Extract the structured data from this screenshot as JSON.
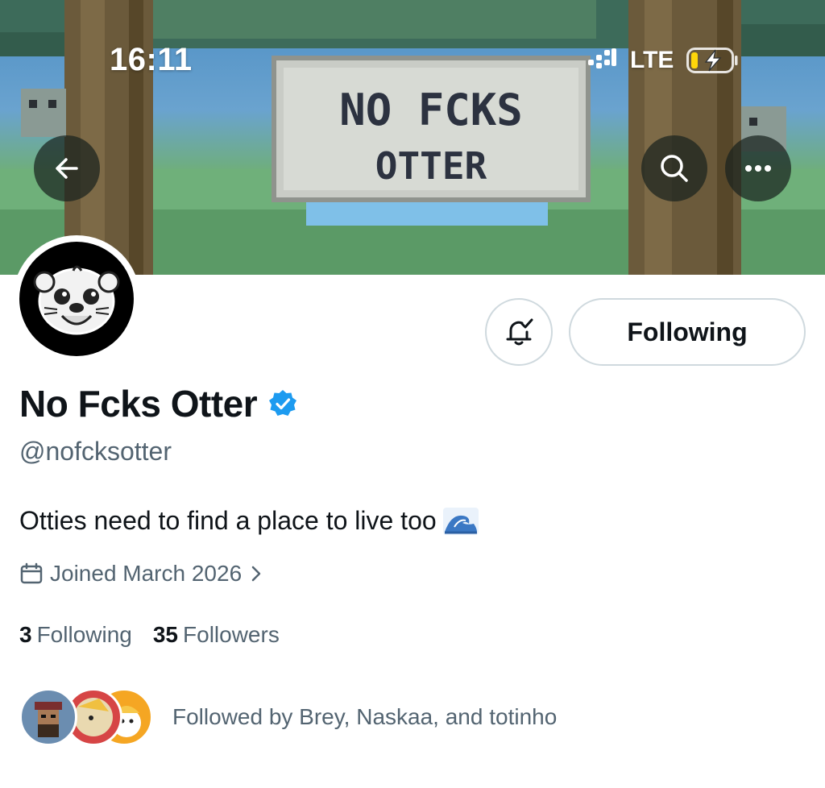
{
  "status_bar": {
    "time": "16:11",
    "network": "LTE",
    "icons": [
      "signal-icon",
      "battery-charging-icon"
    ]
  },
  "banner": {
    "sign_line1": "NO FCKS",
    "sign_line2": "OTTER",
    "buttons": [
      "back-arrow-icon",
      "search-icon",
      "more-icon"
    ]
  },
  "profile": {
    "display_name": "No Fcks Otter",
    "verified": true,
    "handle": "@nofcksotter",
    "bio": "Otties need to find a place to live too",
    "bio_emoji": "🌊",
    "joined": "Joined March 2026",
    "following_count": "3",
    "following_label": "Following",
    "followers_count": "35",
    "followers_label": "Followers",
    "followed_by": "Followed by Brey, Naskaa, and totinho"
  },
  "actions": {
    "following_button": "Following",
    "notify_icon": "bell-check-icon"
  },
  "colors": {
    "verified_blue": "#1d9bf0",
    "text_primary": "#0f1419",
    "text_secondary": "#536471",
    "border": "#cfd9de"
  }
}
